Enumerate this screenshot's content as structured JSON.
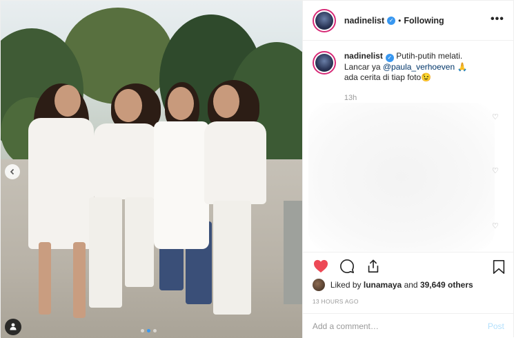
{
  "header": {
    "username": "nadinelist",
    "separator": "•",
    "follow_status": "Following",
    "more_label": "•••"
  },
  "caption": {
    "username": "nadinelist",
    "text_1": "Putih-putih melati.",
    "text_2": "Lancar ya",
    "mention": "@paula_verhoeven",
    "emoji_1": "🙏",
    "text_3": "ada cerita di tiap foto",
    "emoji_2": "😉",
    "time": "13h"
  },
  "likes": {
    "prefix": "Liked by",
    "liker": "lunamaya",
    "and": "and",
    "others": "39,649 others"
  },
  "timestamp": "13 HOURS AGO",
  "comment": {
    "placeholder": "Add a comment…",
    "post_label": "Post"
  },
  "icons": {
    "like": "heart-icon",
    "comment": "comment-icon",
    "share": "share-icon",
    "save": "bookmark-icon",
    "verified": "verified-badge-icon",
    "prev": "chevron-left-icon",
    "tag": "user-tag-icon"
  },
  "colors": {
    "like_red": "#ed4956",
    "link_blue": "#3897f0",
    "post_disabled": "#b2dffc"
  },
  "carousel": {
    "count": 3,
    "active_index": 1
  }
}
